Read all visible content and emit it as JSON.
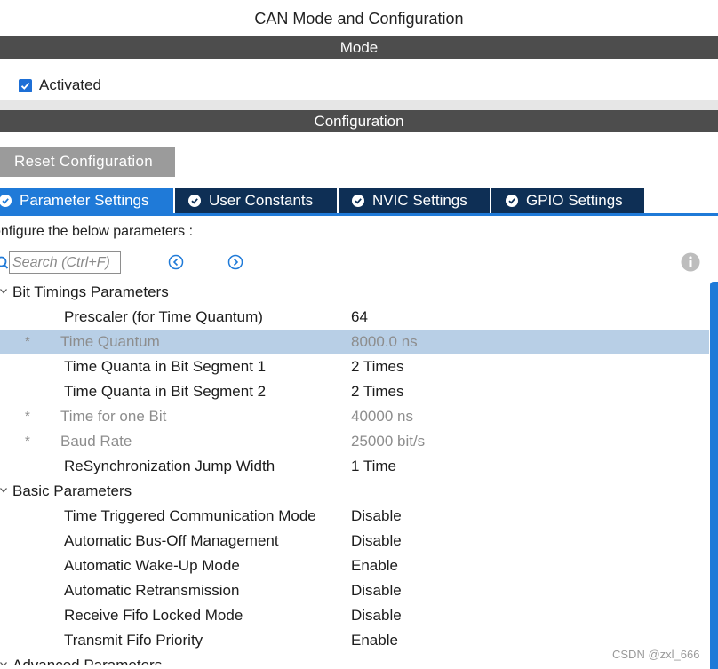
{
  "window": {
    "title": "CAN Mode and Configuration"
  },
  "mode": {
    "header": "Mode",
    "activated_label": "Activated",
    "activated": true
  },
  "configuration": {
    "header": "Configuration",
    "reset_label": "Reset Configuration",
    "tabs": [
      {
        "label": "Parameter Settings",
        "active": true
      },
      {
        "label": "User Constants",
        "active": false
      },
      {
        "label": "NVIC Settings",
        "active": false
      },
      {
        "label": "GPIO Settings",
        "active": false
      }
    ],
    "instructions": "onfigure the below parameters :",
    "search_placeholder": "Search (Ctrl+F)"
  },
  "groups": [
    {
      "name": "Bit Timings Parameters",
      "params": [
        {
          "label": "Prescaler (for Time Quantum)",
          "value": "64",
          "derived": false
        },
        {
          "label": "Time Quantum",
          "value": "8000.0 ns",
          "derived": true,
          "selected": true
        },
        {
          "label": "Time Quanta in Bit Segment 1",
          "value": "2 Times",
          "derived": false
        },
        {
          "label": "Time Quanta in Bit Segment 2",
          "value": "2 Times",
          "derived": false
        },
        {
          "label": "Time for one Bit",
          "value": "40000 ns",
          "derived": true
        },
        {
          "label": "Baud Rate",
          "value": "25000 bit/s",
          "derived": true
        },
        {
          "label": "ReSynchronization Jump Width",
          "value": "1 Time",
          "derived": false
        }
      ]
    },
    {
      "name": "Basic Parameters",
      "params": [
        {
          "label": "Time Triggered Communication Mode",
          "value": "Disable"
        },
        {
          "label": "Automatic Bus-Off Management",
          "value": "Disable"
        },
        {
          "label": "Automatic Wake-Up Mode",
          "value": "Enable"
        },
        {
          "label": "Automatic Retransmission",
          "value": "Disable"
        },
        {
          "label": "Receive Fifo Locked Mode",
          "value": "Disable"
        },
        {
          "label": "Transmit Fifo Priority",
          "value": "Enable"
        }
      ]
    },
    {
      "name": "Advanced Parameters"
    }
  ],
  "derived_marker": "*",
  "watermark": "CSDN @zxl_666",
  "colors": {
    "accent": "#1f7ad8",
    "tab_inactive": "#0e2f55",
    "section_bar": "#4d4d4d",
    "selected_row": "#b8cfe6"
  }
}
